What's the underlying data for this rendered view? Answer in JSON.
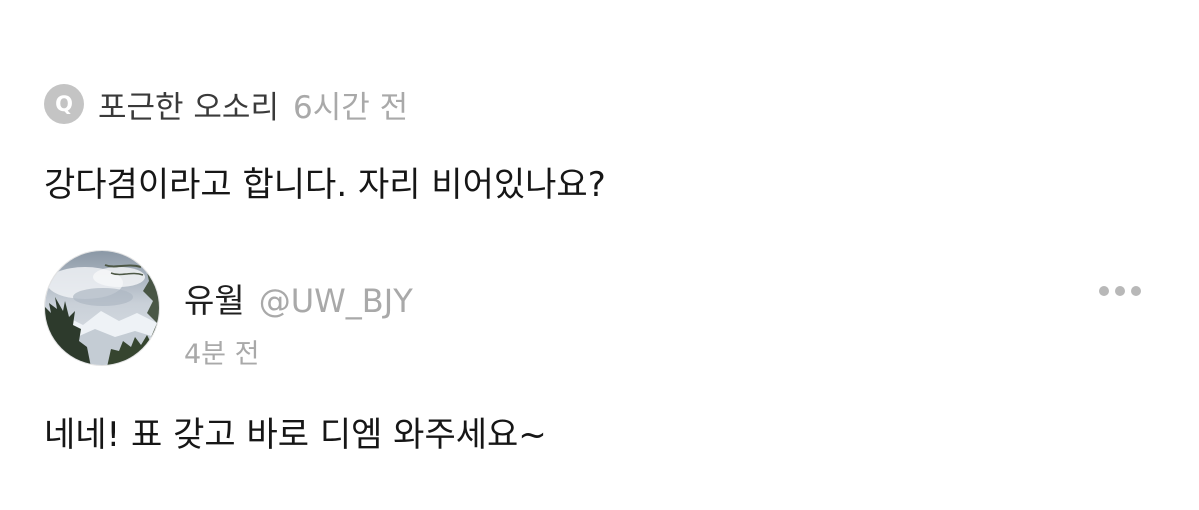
{
  "question": {
    "badge_letter": "Q",
    "asker_name": "포근한 오소리",
    "time_ago": "6시간 전",
    "text": "강다겸이라고 합니다. 자리 비어있나요?"
  },
  "answer": {
    "avatar_icon": "profile-photo-landscape",
    "name": "유월",
    "handle": "@UW_BJY",
    "time_ago": "4분 전",
    "text": "네네! 표 갖고 바로 디엠 와주세요~",
    "more_icon": "more-horizontal-icon"
  },
  "colors": {
    "badge_bg": "#c4c4c4",
    "muted_text": "#a9a9a9",
    "primary_text": "#1f1f1f"
  }
}
